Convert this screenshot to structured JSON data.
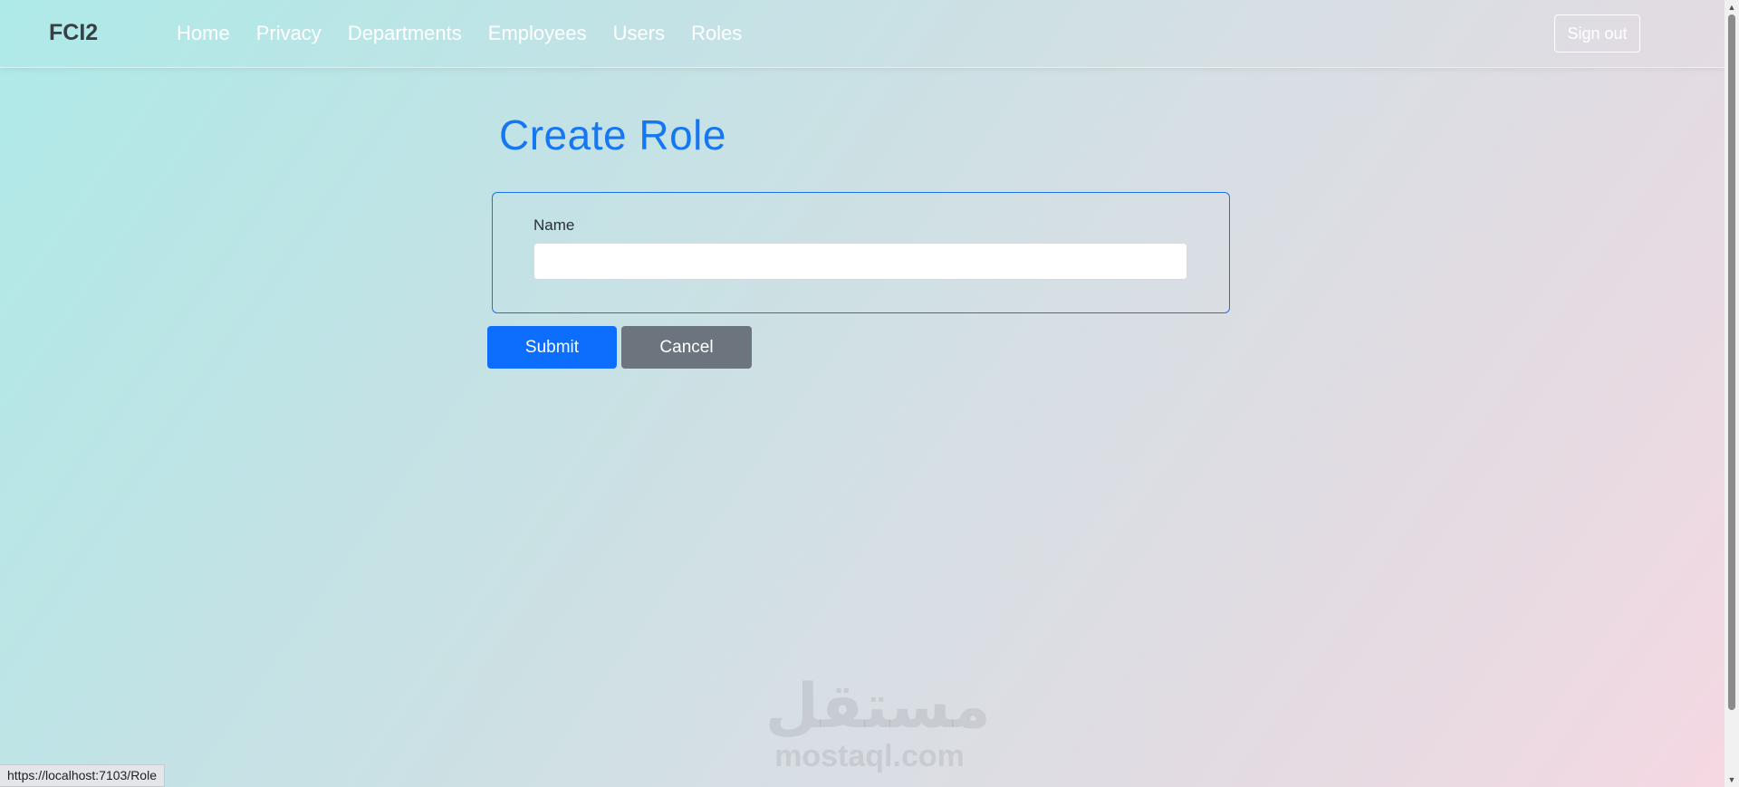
{
  "navbar": {
    "brand": "FCI2",
    "links": [
      "Home",
      "Privacy",
      "Departments",
      "Employees",
      "Users",
      "Roles"
    ],
    "signout_label": "Sign out"
  },
  "page": {
    "title": "Create Role"
  },
  "form": {
    "name_label": "Name",
    "name_value": "",
    "name_placeholder": ""
  },
  "actions": {
    "submit_label": "Submit",
    "cancel_label": "Cancel"
  },
  "watermark": {
    "arabic": "مستقل",
    "latin": "mostaql.com"
  },
  "status_bar": {
    "url": "https://localhost:7103/Role"
  },
  "colors": {
    "accent": "#0d6efd",
    "title": "#1677f2",
    "cancel": "#6c757d"
  },
  "icons": {
    "scroll_up": "chevron-up-icon",
    "scroll_down": "chevron-down-icon"
  }
}
